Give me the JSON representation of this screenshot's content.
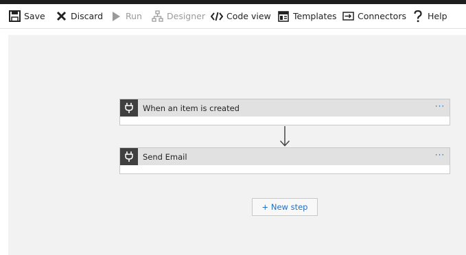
{
  "toolbar": {
    "items": [
      {
        "label": "Save",
        "icon": "save-icon",
        "enabled": true
      },
      {
        "label": "Discard",
        "icon": "close-icon",
        "enabled": true
      },
      {
        "label": "Run",
        "icon": "play-icon",
        "enabled": false
      },
      {
        "label": "Designer",
        "icon": "designer-icon",
        "enabled": false
      },
      {
        "label": "Code view",
        "icon": "code-icon",
        "enabled": true
      },
      {
        "label": "Templates",
        "icon": "templates-icon",
        "enabled": true
      },
      {
        "label": "Connectors",
        "icon": "connectors-icon",
        "enabled": true
      },
      {
        "label": "Help",
        "icon": "help-icon",
        "enabled": true
      }
    ]
  },
  "flow": {
    "steps": [
      {
        "title": "When an item is created",
        "icon": "plug-icon",
        "more": "···"
      },
      {
        "title": "Send Email",
        "icon": "plug-icon",
        "more": "···"
      }
    ],
    "new_step_label": "+ New step"
  },
  "colors": {
    "accent": "#1f6fc5",
    "topbar": "#1e1e1e",
    "canvas": "#f2f2f2",
    "card_header": "#e1e1e1",
    "card_icon_bg": "#404040"
  }
}
